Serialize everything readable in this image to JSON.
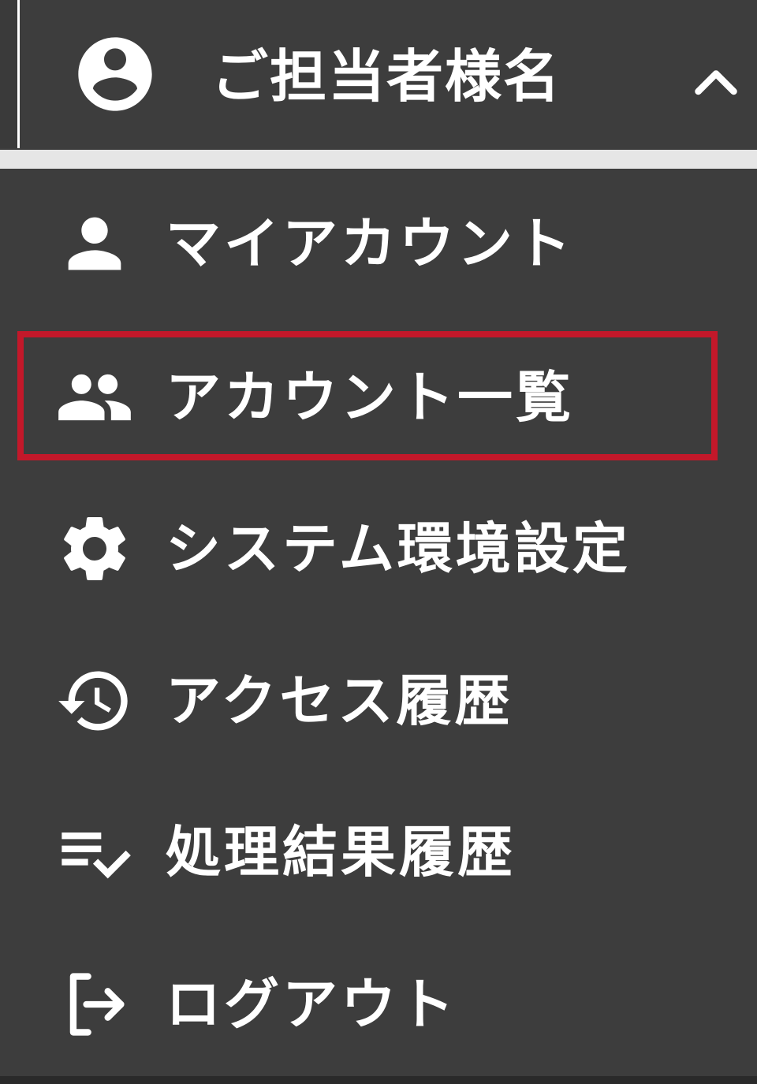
{
  "header": {
    "account_name": "ご担当者様名",
    "avatar_icon": "account-circle-icon",
    "toggle_icon": "chevron-up-icon"
  },
  "menu": {
    "items": [
      {
        "label": "マイアカウント",
        "icon": "person-icon"
      },
      {
        "label": "アカウント一覧",
        "icon": "people-icon",
        "highlighted": true
      },
      {
        "label": "システム環境設定",
        "icon": "gear-icon"
      },
      {
        "label": "アクセス履歴",
        "icon": "history-icon"
      },
      {
        "label": "処理結果履歴",
        "icon": "playlist-check-icon"
      },
      {
        "label": "ログアウト",
        "icon": "logout-icon"
      }
    ]
  },
  "colors": {
    "background": "#3d3d3d",
    "text": "#ffffff",
    "highlight": "#c3182a",
    "separator": "#e6e6e6"
  }
}
